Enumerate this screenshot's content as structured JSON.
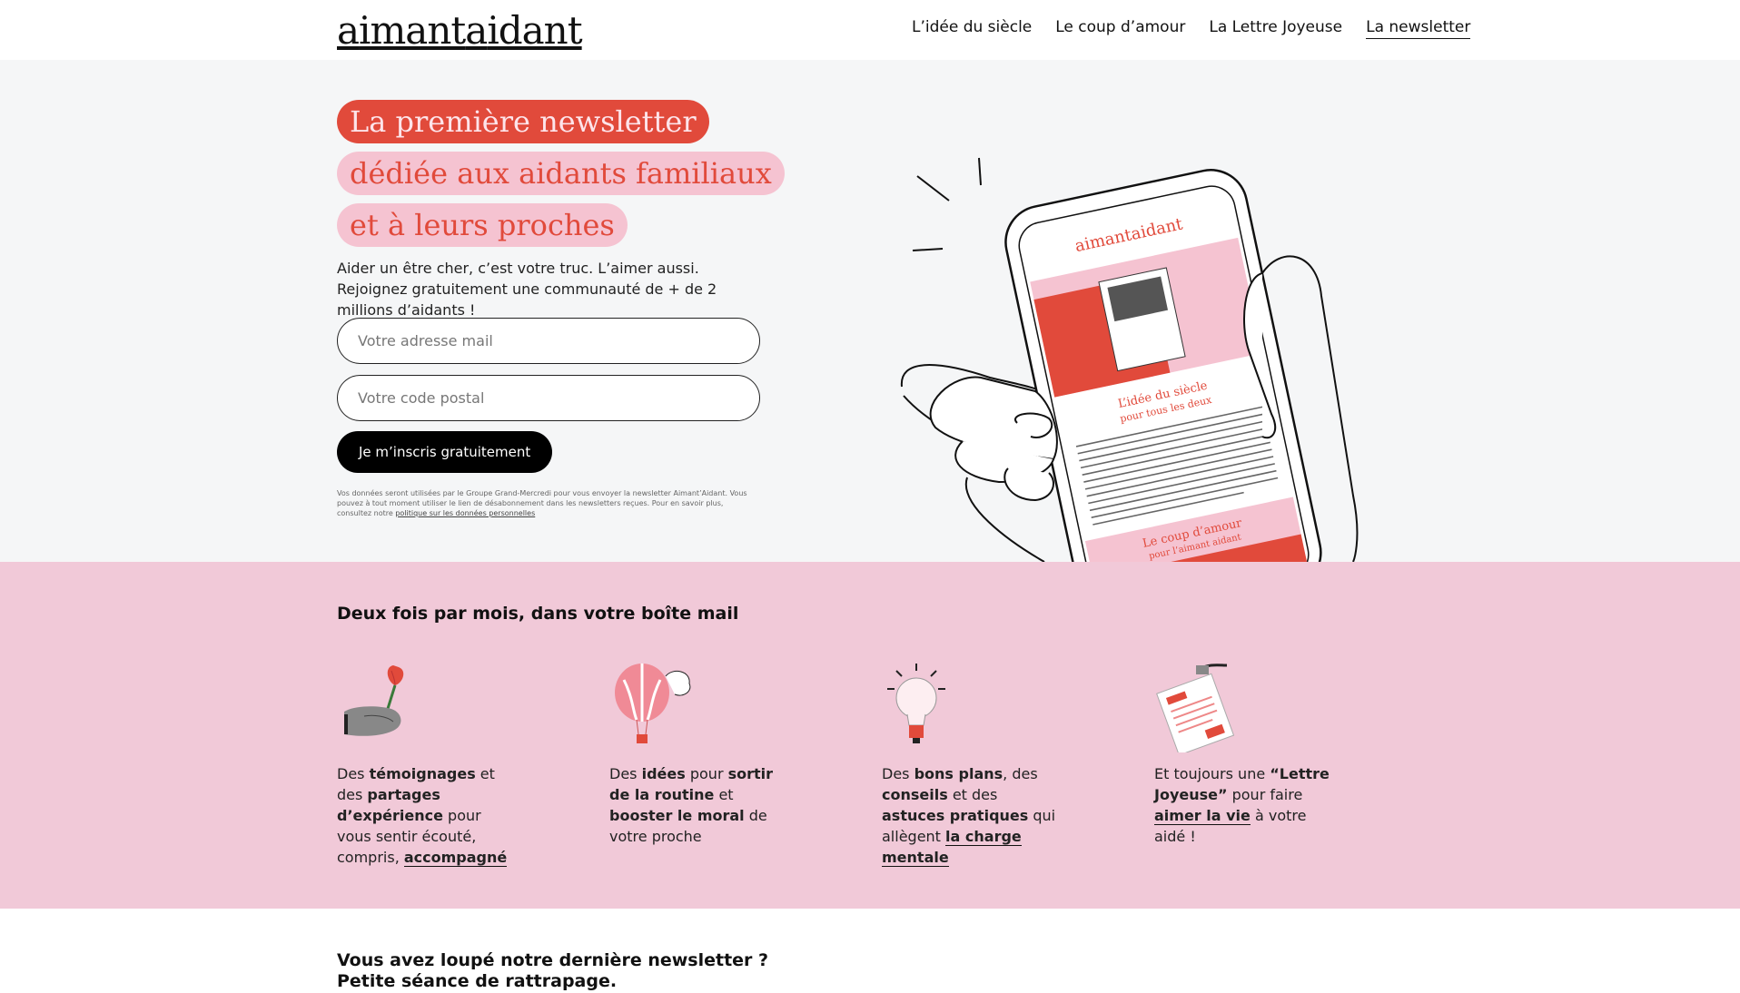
{
  "header": {
    "logo": {
      "part1": "a",
      "part2": "imant",
      "part3": "a",
      "part4": "idant"
    },
    "nav": [
      {
        "label": "L’idée du siècle"
      },
      {
        "label": "Le coup d’amour"
      },
      {
        "label": "La Lettre Joyeuse"
      },
      {
        "label": "La newsletter",
        "active": true
      }
    ]
  },
  "hero": {
    "headline": [
      "La première newsletter",
      "dédiée aux aidants familiaux",
      "et à leurs proches"
    ],
    "intro": "Aider un être cher, c’est votre truc. L’aimer aussi. Rejoignez gratuitement une communauté de + de 2 millions d’aidants !",
    "email_placeholder": "Votre adresse mail",
    "postal_placeholder": "Votre code postal",
    "cta_label": "Je m’inscris gratuitement",
    "legal_text": "Vos données seront utilisées par le Groupe Grand-Mercredi pour vous envoyer la newsletter Aimant’Aidant. Vous pouvez à tout moment utiliser le lien de désabonnement dans les newsletters reçues. Pour en savoir plus, consultez notre ",
    "legal_link": "politique sur les données personnelles",
    "phone": {
      "logo": "aimantaidant",
      "section1_title": "L’idée du siècle",
      "section1_sub": "pour tous les deux",
      "section2_title": "Le coup d’amour",
      "section2_sub": "pour l’aimant aidant"
    }
  },
  "band": {
    "title": "Deux fois par mois, dans votre boîte mail",
    "features": [
      {
        "icon": "hand-flower-icon",
        "parts": [
          "Des ",
          "témoignages",
          " et des ",
          "partages d’expérience",
          " pour vous sentir écouté, compris, ",
          "accompagné"
        ]
      },
      {
        "icon": "hot-air-balloon-icon",
        "parts": [
          "Des ",
          "idées",
          " pour ",
          "sortir de la routine",
          " et ",
          "booster le moral",
          " de votre proche"
        ]
      },
      {
        "icon": "lightbulb-icon",
        "parts": [
          "Des ",
          "bons plans",
          ", des ",
          "conseils",
          " et des ",
          "astuces pratiques",
          " qui allègent ",
          "la charge mentale"
        ]
      },
      {
        "icon": "letter-icon",
        "parts": [
          "Et toujours une ",
          "“Lettre Joyeuse”",
          " pour faire ",
          "aimer la vie",
          " à votre aidé !"
        ]
      }
    ]
  },
  "bottom": {
    "title_line1": "Vous avez loupé notre dernière newsletter ?",
    "title_line2": "Petite séance de rattrapage."
  },
  "colors": {
    "accent": "#e14a3b",
    "pink": "#f1c9d8",
    "light_pink": "#f5c3d1",
    "hero_bg": "#f5f6f7"
  }
}
